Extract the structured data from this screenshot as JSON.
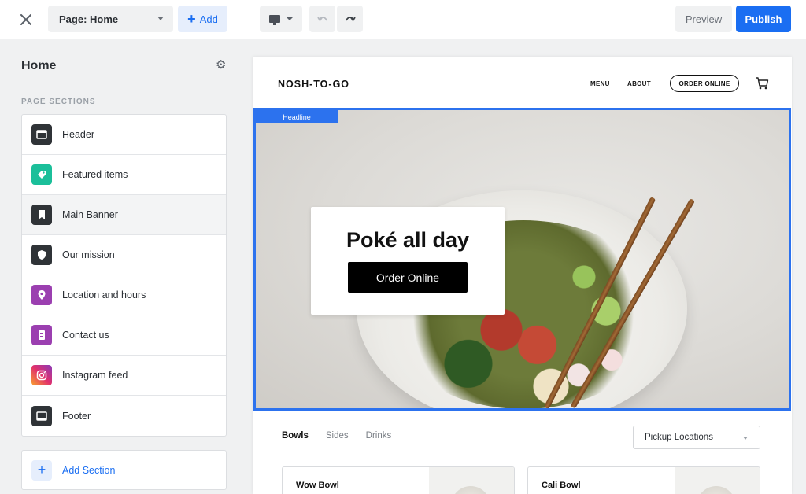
{
  "topbar": {
    "page_select_value": "Page: Home",
    "add_label": "Add",
    "preview_label": "Preview",
    "publish_label": "Publish"
  },
  "sidebar": {
    "title": "Home",
    "section_heading": "PAGE SECTIONS",
    "items": [
      {
        "label": "Header",
        "icon": "header-icon",
        "color": "#2f3337"
      },
      {
        "label": "Featured items",
        "icon": "tag-icon",
        "color": "#1bbf9a"
      },
      {
        "label": "Main Banner",
        "icon": "bookmark-icon",
        "color": "#2f3337"
      },
      {
        "label": "Our mission",
        "icon": "shield-icon",
        "color": "#2f3337"
      },
      {
        "label": "Location and hours",
        "icon": "location-pin-icon",
        "color": "#9b3fb0"
      },
      {
        "label": "Contact us",
        "icon": "contact-card-icon",
        "color": "#9b3fb0"
      },
      {
        "label": "Instagram feed",
        "icon": "instagram-icon",
        "color": "#e1306c"
      },
      {
        "label": "Footer",
        "icon": "footer-icon",
        "color": "#2f3337"
      }
    ],
    "active_item": "Main Banner",
    "add_section_label": "Add Section"
  },
  "site": {
    "brand": "NOSH-TO-GO",
    "nav_menu": "MENU",
    "nav_about": "ABOUT",
    "nav_order": "ORDER ONLINE",
    "headline_tag": "Headline",
    "hero_title": "Poké all day",
    "hero_button": "Order Online",
    "tabs": [
      "Bowls",
      "Sides",
      "Drinks"
    ],
    "active_tab": "Bowls",
    "location_select": "Pickup Locations",
    "cards": [
      "Wow Bowl",
      "Cali Bowl"
    ]
  },
  "colors": {
    "accent": "#1a6ef2",
    "selection": "#2c72ee"
  }
}
